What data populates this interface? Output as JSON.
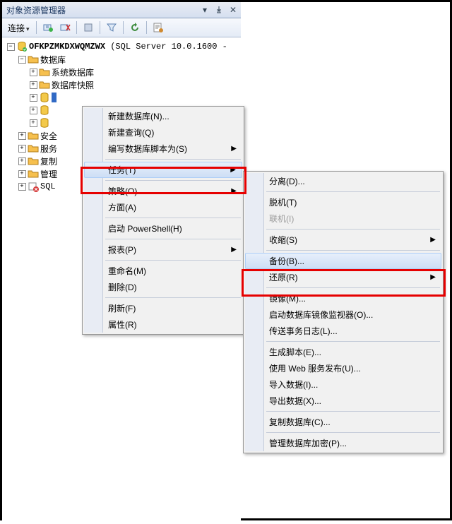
{
  "title": "对象资源管理器",
  "toolbar": {
    "connect": "连接"
  },
  "tree": {
    "server": {
      "name": "OFKPZMKDXWQMZWX",
      "info": "(SQL Server 10.0.1600 -"
    },
    "databases": "数据库",
    "sysdb": "系统数据库",
    "snapshot": "数据库快照",
    "security": "安全",
    "server_obj": "服务",
    "replication": "复制",
    "management": "管理",
    "agent": "SQL"
  },
  "menu1": {
    "newdb": "新建数据库(N)...",
    "newquery": "新建查询(Q)",
    "scriptas": "编写数据库脚本为(S)",
    "tasks": "任务(T)",
    "policies": "策略(O)",
    "facets": "方面(A)",
    "ps": "启动 PowerShell(H)",
    "reports": "报表(P)",
    "rename": "重命名(M)",
    "delete": "删除(D)",
    "refresh": "刷新(F)",
    "props": "属性(R)"
  },
  "menu2": {
    "detach": "分离(D)...",
    "offline": "脱机(T)",
    "online": "联机(I)",
    "shrink": "收缩(S)",
    "backup": "备份(B)...",
    "restore": "还原(R)",
    "mirror": "镜像(M)...",
    "launchmon": "启动数据库镜像监视器(O)...",
    "shiplog": "传送事务日志(L)...",
    "genscript": "生成脚本(E)...",
    "webpub": "使用 Web 服务发布(U)...",
    "importdata": "导入数据(I)...",
    "exportdata": "导出数据(X)...",
    "copydb": "复制数据库(C)...",
    "encrypt": "管理数据库加密(P)..."
  }
}
